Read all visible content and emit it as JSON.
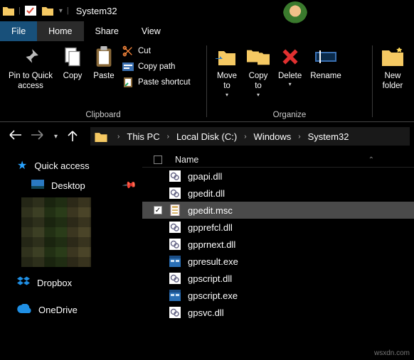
{
  "window_title": "System32",
  "menu": {
    "file": "File",
    "home": "Home",
    "share": "Share",
    "view": "View"
  },
  "ribbon": {
    "pin": "Pin to Quick\naccess",
    "copy": "Copy",
    "paste": "Paste",
    "cut": "Cut",
    "copy_path": "Copy path",
    "paste_shortcut": "Paste shortcut",
    "clipboard_group": "Clipboard",
    "move_to": "Move\nto",
    "copy_to": "Copy\nto",
    "delete": "Delete",
    "rename": "Rename",
    "new_folder": "New\nfolder",
    "organize_group": "Organize"
  },
  "breadcrumb": [
    "This PC",
    "Local Disk (C:)",
    "Windows",
    "System32"
  ],
  "sidebar": {
    "quick_access": "Quick access",
    "desktop": "Desktop",
    "dropbox": "Dropbox",
    "onedrive": "OneDrive"
  },
  "files": {
    "header_name": "Name",
    "rows": [
      {
        "name": "gpapi.dll",
        "type": "dll",
        "selected": false
      },
      {
        "name": "gpedit.dll",
        "type": "dll",
        "selected": false
      },
      {
        "name": "gpedit.msc",
        "type": "msc",
        "selected": true
      },
      {
        "name": "gpprefcl.dll",
        "type": "dll",
        "selected": false
      },
      {
        "name": "gpprnext.dll",
        "type": "dll",
        "selected": false
      },
      {
        "name": "gpresult.exe",
        "type": "exe",
        "selected": false
      },
      {
        "name": "gpscript.dll",
        "type": "dll",
        "selected": false
      },
      {
        "name": "gpscript.exe",
        "type": "exe",
        "selected": false
      },
      {
        "name": "gpsvc.dll",
        "type": "dll",
        "selected": false
      }
    ]
  },
  "watermark": "wsxdn.com"
}
